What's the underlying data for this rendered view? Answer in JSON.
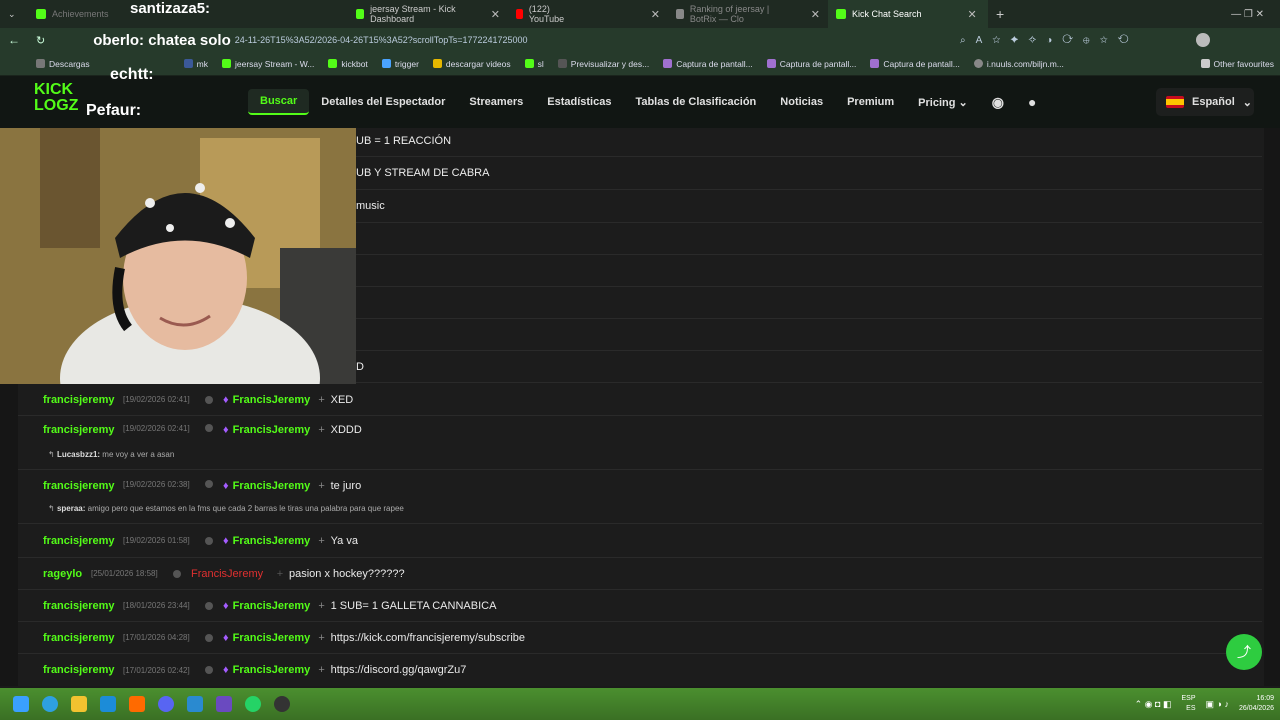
{
  "browser": {
    "tabs": [
      {
        "label": "Achievements",
        "color": "#53fc18",
        "active": false
      },
      {
        "label": "santizaza5:",
        "color": "#ffd400",
        "active": false
      },
      {
        "label": "jeersay Stream - Kick Dashboard",
        "color": "#53fc18",
        "active": false
      },
      {
        "label": "(122) YouTube",
        "color": "#ff0000",
        "active": false
      },
      {
        "label": "Ranking of jeersay | BotRix — Clo",
        "color": "#888888",
        "active": false
      },
      {
        "label": "Kick Chat Search",
        "color": "#53fc18",
        "active": true
      }
    ],
    "address": "oberlo: chatea solo",
    "url_tail": "24-11-26T15%3A52/2026-04-26T15%3A52?scrollTopTs=1772241725000",
    "bookmarks": [
      "Descargas",
      "mk",
      "jeersay Stream - W...",
      "kickbot",
      "trigger",
      "descargar videos",
      "sl",
      "Previsualizar y des...",
      "Captura de pantall...",
      "Captura de pantall...",
      "Captura de pantall...",
      "i.nuuls.com/biljn.m..."
    ],
    "other_favourites": "Other favourites"
  },
  "site": {
    "logo": "KICK LOGZ",
    "overlay_names": [
      "echtt:",
      "Pefaur:"
    ],
    "nav": [
      "Buscar",
      "Detalles del Espectador",
      "Streamers",
      "Estadísticas",
      "Tablas de Clasificación",
      "Noticias",
      "Premium",
      "Pricing"
    ],
    "language": "Español"
  },
  "partial_messages": [
    "UB = 1 REACCIÓN",
    "UB Y STREAM DE CABRA",
    "music",
    "D"
  ],
  "messages": [
    {
      "user": "francisjeremy",
      "time": "[19/02/2026 02:41]",
      "channel": "FrancisJeremy",
      "text": "XED",
      "reply": null
    },
    {
      "user": "francisjeremy",
      "time": "[19/02/2026 02:41]",
      "channel": "FrancisJeremy",
      "text": "XDDD",
      "reply": {
        "user": "Lucasbzz1:",
        "text": "me voy a ver a asan"
      }
    },
    {
      "user": "francisjeremy",
      "time": "[19/02/2026 02:38]",
      "channel": "FrancisJeremy",
      "text": "te juro",
      "reply": {
        "user": "speraa:",
        "text": "amigo pero que estamos en la fms que cada 2 barras le tiras una palabra para que rapee"
      }
    },
    {
      "user": "francisjeremy",
      "time": "[19/02/2026 01:58]",
      "channel": "FrancisJeremy",
      "text": "Ya va",
      "reply": null
    },
    {
      "user": "rageylo",
      "time": "[25/01/2026 18:58]",
      "channel": "FrancisJeremy",
      "text": "pasion x hockey??????",
      "reply": null,
      "alt": true
    },
    {
      "user": "francisjeremy",
      "time": "[18/01/2026 23:44]",
      "channel": "FrancisJeremy",
      "text": "1 SUB= 1 GALLETA CANNABICA",
      "reply": null
    },
    {
      "user": "francisjeremy",
      "time": "[17/01/2026 04:28]",
      "channel": "FrancisJeremy",
      "text": "https://kick.com/francisjeremy/subscribe",
      "reply": null
    },
    {
      "user": "francisjeremy",
      "time": "[17/01/2026 02:42]",
      "channel": "FrancisJeremy",
      "text": "https://discord.gg/qawgrZu7",
      "reply": null
    }
  ],
  "taskbar": {
    "lang": "ESP",
    "lang2": "ES",
    "time": "16:09",
    "date": "26/04/2026"
  }
}
